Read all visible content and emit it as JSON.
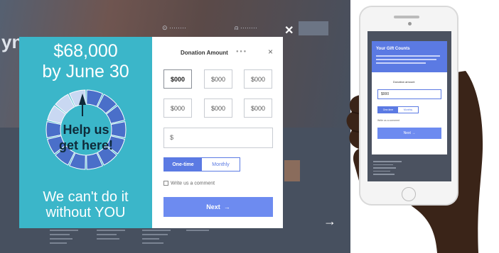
{
  "background": {
    "logo_text": "yn",
    "nav_location": "⊙ ········",
    "nav_user": "⍝ ········",
    "close_glyph": "✕",
    "arrow_glyph": "→"
  },
  "promo": {
    "goal": "$68,000",
    "date": "by June 30",
    "help_line1": "Help us",
    "help_line2": "get here!",
    "cta_line1": "We can't do it",
    "cta_line2": "without YOU",
    "ring": {
      "segments": 14,
      "filled_light": 3
    },
    "colors": {
      "panel": "#3bb6c9",
      "ring_dark": "#4a6fc9",
      "ring_light": "#c9d8f2"
    }
  },
  "donation_form": {
    "title": "Donation Amount",
    "step_dots": "● ● ●",
    "close_icon": "×",
    "amounts": [
      "$000",
      "$000",
      "$000",
      "$000",
      "$000",
      "$000"
    ],
    "custom_amount": "$",
    "frequency": {
      "options": [
        "One-time",
        "Monthly"
      ],
      "selected": "One-time"
    },
    "comment_label": "Write us a comment",
    "next_label": "Next",
    "next_arrow": "→",
    "accent_color": "#5b7ae3"
  },
  "phone": {
    "header_title": "Your Gift Counts",
    "donation_label": "Donation amount",
    "amount_value": "$000",
    "frequency": {
      "options": [
        "One-time",
        "Monthly"
      ]
    },
    "comment_label": "Write us a comment",
    "next_label": "Next →"
  }
}
